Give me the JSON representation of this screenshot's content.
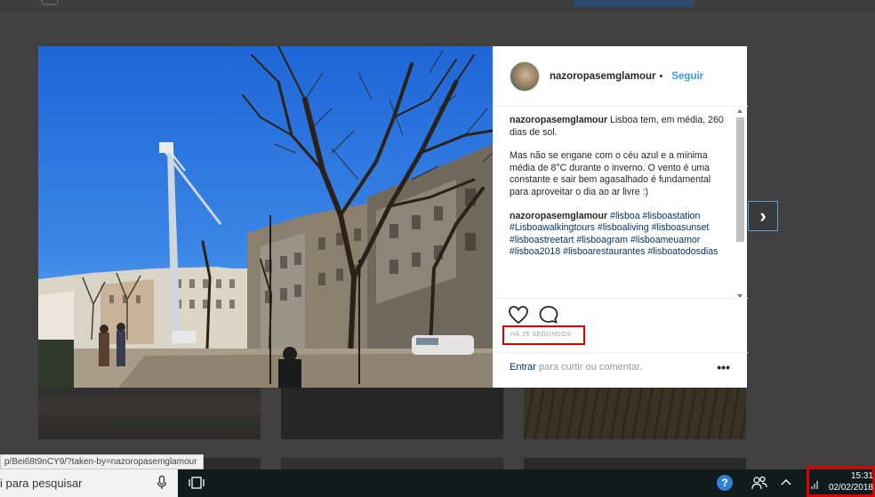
{
  "post": {
    "username": "nazoropasemglamour",
    "separator": "•",
    "follow_label": "Seguir",
    "caption_user": "nazoropasemglamour",
    "caption_line1": "Lisboa tem, em média, 260 dias de sol.",
    "caption_para2": "Mas não se engane com o céu azul e a mínima média de 8°C durante o inverno. O vento é uma constante e sair bem agasalhado é fundamental para aproveitar o dia ao ar livre :)",
    "hashtag_user": "nazoropasemglamour",
    "hashtags": "#lisboa #lisboastation #Lisboawalkingtours #lisboaliving #lisboasunset #lisboastreetart #lisboagram #lisboameuamor #lisboa2018 #lisboarestaurantes #lisboatodosdias",
    "timestamp": "HÁ 25 SEGUNDOS",
    "login_link": "Entrar",
    "login_suffix": " para curtir ou comentar.",
    "more_label": "•••"
  },
  "navigation": {
    "next_label": "›"
  },
  "status_url": "p/Bei68t9nCY9/?taken-by=nazoropasemglamour",
  "taskbar": {
    "search_placeholder": "i para pesquisar",
    "help_label": "?",
    "people_label": "ᴿᴿ",
    "caret_label": "^",
    "time": "15:31",
    "date": "02/02/2018"
  },
  "icons": {
    "heart": "heart-icon",
    "comment": "comment-icon",
    "mic": "microphone-icon",
    "taskview": "task-view-icon",
    "wifi": "wifi-icon"
  },
  "colors": {
    "link_blue": "#3897f0",
    "hashtag_blue": "#003569",
    "highlight_red": "#e00000",
    "taskbar": "#101c1c"
  }
}
